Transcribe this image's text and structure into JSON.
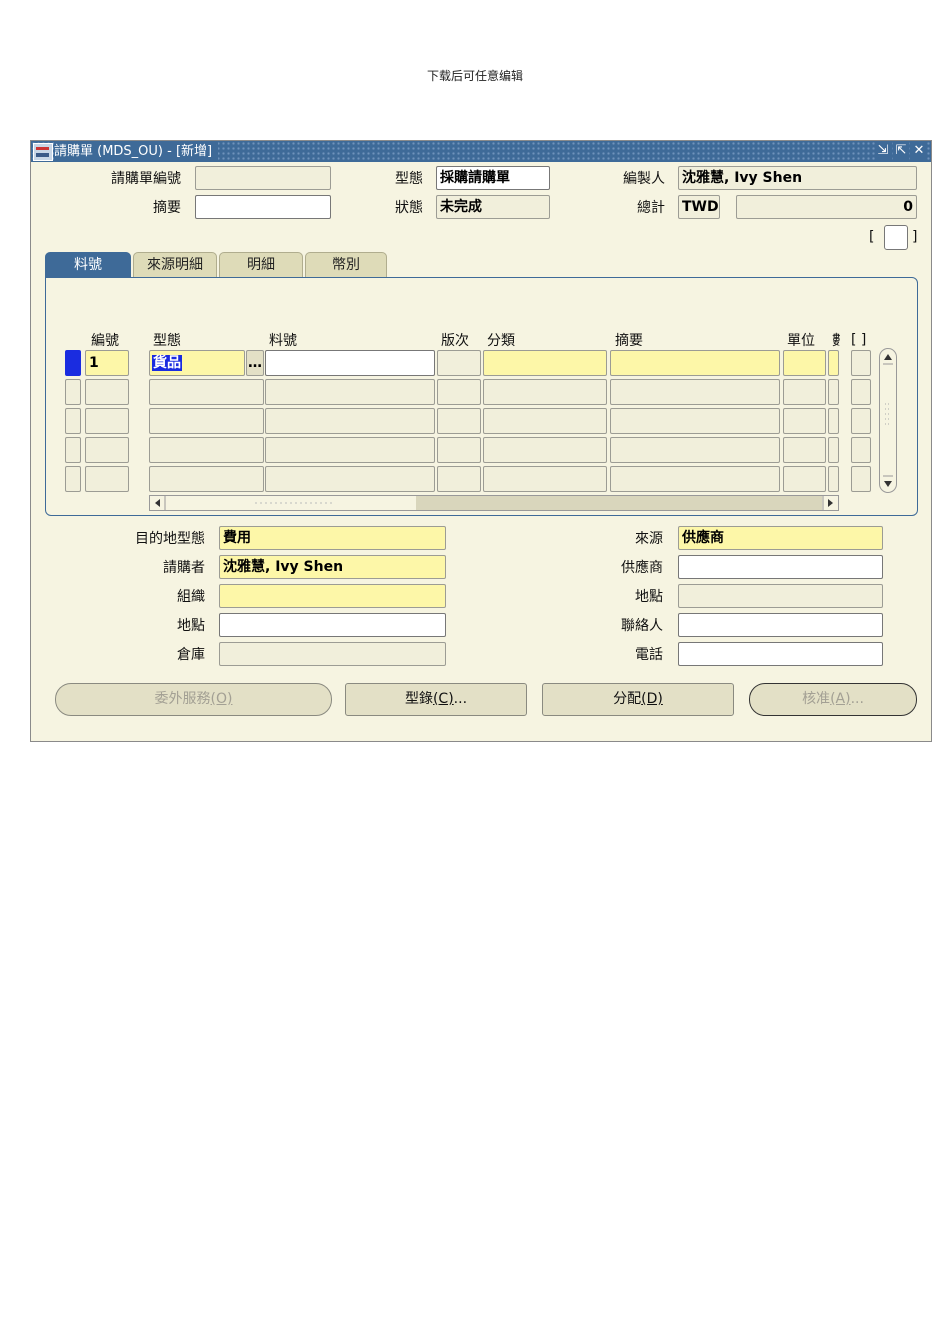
{
  "note": "下载后可任意编辑",
  "window": {
    "title": "請購單 (MDS_OU) - [新增]",
    "controls": [
      "⇲",
      "⇱",
      "✕"
    ]
  },
  "header": {
    "req_no_label": "請購單編號",
    "req_no_value": "",
    "desc_label": "摘要",
    "desc_value": "",
    "type_label": "型態",
    "type_value": "採購請購單",
    "status_label": "狀態",
    "status_value": "未完成",
    "preparer_label": "編製人",
    "preparer_value": "沈雅慧, Ivy Shen",
    "total_label": "總計",
    "currency": "TWD",
    "total_value": "0",
    "bracket_left": "[",
    "bracket_right": "]"
  },
  "tabs": [
    "料號",
    "來源明細",
    "明細",
    "幣別"
  ],
  "lines": {
    "columns": {
      "num": "編號",
      "type": "型態",
      "item": "料號",
      "rev": "版次",
      "category": "分類",
      "description": "摘要",
      "uom": "單位",
      "qty": "數",
      "flag": "[ ]"
    },
    "rows": [
      {
        "num": "1",
        "type": "貨品",
        "item": "",
        "rev": "",
        "category": "",
        "description": "",
        "uom": "",
        "qty": ""
      },
      {
        "num": "",
        "type": "",
        "item": "",
        "rev": "",
        "category": "",
        "description": "",
        "uom": "",
        "qty": ""
      },
      {
        "num": "",
        "type": "",
        "item": "",
        "rev": "",
        "category": "",
        "description": "",
        "uom": "",
        "qty": ""
      },
      {
        "num": "",
        "type": "",
        "item": "",
        "rev": "",
        "category": "",
        "description": "",
        "uom": "",
        "qty": ""
      },
      {
        "num": "",
        "type": "",
        "item": "",
        "rev": "",
        "category": "",
        "description": "",
        "uom": "",
        "qty": ""
      }
    ],
    "lov_button": "…"
  },
  "details": {
    "dest_type_label": "目的地型態",
    "dest_type_value": "費用",
    "requester_label": "請購者",
    "requester_value": "沈雅慧, Ivy Shen",
    "org_label": "組織",
    "org_value": "",
    "location_label": "地點",
    "location_value": "",
    "subinv_label": "倉庫",
    "subinv_value": "",
    "source_label": "來源",
    "source_value": "供應商",
    "supplier_label": "供應商",
    "supplier_value": "",
    "site_label": "地點",
    "site_value": "",
    "contact_label": "聯絡人",
    "contact_value": "",
    "phone_label": "電話",
    "phone_value": ""
  },
  "buttons": {
    "outside_services": "委外服務",
    "outside_services_key": "(O)",
    "catalog": "型錄",
    "catalog_key": "(C)",
    "catalog_suffix": "...",
    "distributions": "分配",
    "distributions_key": "(D)",
    "approve": "核准",
    "approve_key": "(A)",
    "approve_suffix": "..."
  }
}
